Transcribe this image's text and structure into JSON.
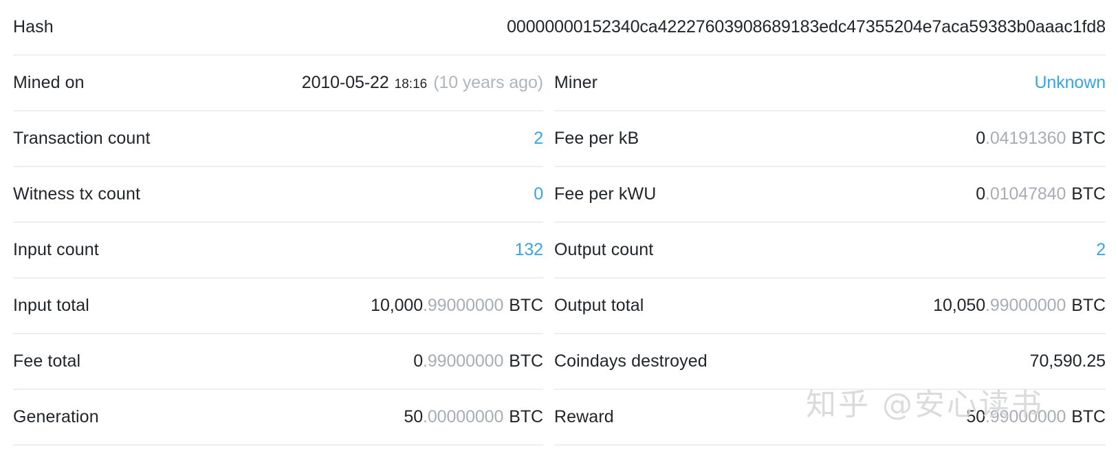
{
  "hash_row": {
    "label": "Hash",
    "value": "00000000152340ca42227603908689183edc47355204e7aca59383b0aaac1fd8"
  },
  "left_column": {
    "rows": [
      {
        "label": "Mined on",
        "date": "2010-05-22",
        "time": "18:16",
        "relative": "(10 years ago)"
      },
      {
        "label": "Transaction count",
        "value": "2",
        "style": "link"
      },
      {
        "label": "Witness tx count",
        "value": "0",
        "style": "link"
      },
      {
        "label": "Input count",
        "value": "132",
        "style": "link"
      },
      {
        "label": "Input total",
        "integer": "10,000",
        "fraction": ".99000000",
        "unit": "BTC",
        "style": "btc"
      },
      {
        "label": "Fee total",
        "integer": "0",
        "fraction": ".99000000",
        "unit": "BTC",
        "style": "btc"
      },
      {
        "label": "Generation",
        "integer": "50",
        "fraction": ".00000000",
        "unit": "BTC",
        "style": "btc"
      }
    ]
  },
  "right_column": {
    "rows": [
      {
        "label": "Miner",
        "value": "Unknown",
        "style": "link"
      },
      {
        "label": "Fee per kB",
        "integer": "0",
        "fraction": ".04191360",
        "unit": "BTC",
        "style": "btc"
      },
      {
        "label": "Fee per kWU",
        "integer": "0",
        "fraction": ".01047840",
        "unit": "BTC",
        "style": "btc"
      },
      {
        "label": "Output count",
        "value": "2",
        "style": "link"
      },
      {
        "label": "Output total",
        "integer": "10,050",
        "fraction": ".99000000",
        "unit": "BTC",
        "style": "btc"
      },
      {
        "label": "Coindays destroyed",
        "value": "70,590.25",
        "style": "plain"
      },
      {
        "label": "Reward",
        "integer": "50",
        "fraction": ".99000000",
        "unit": "BTC",
        "style": "btc"
      }
    ]
  },
  "watermark": {
    "text": "知乎 @安心读书"
  },
  "colors": {
    "link": "#39a3e5",
    "text": "#212529",
    "muted": "#adb5bd",
    "divider": "#eceeef"
  }
}
